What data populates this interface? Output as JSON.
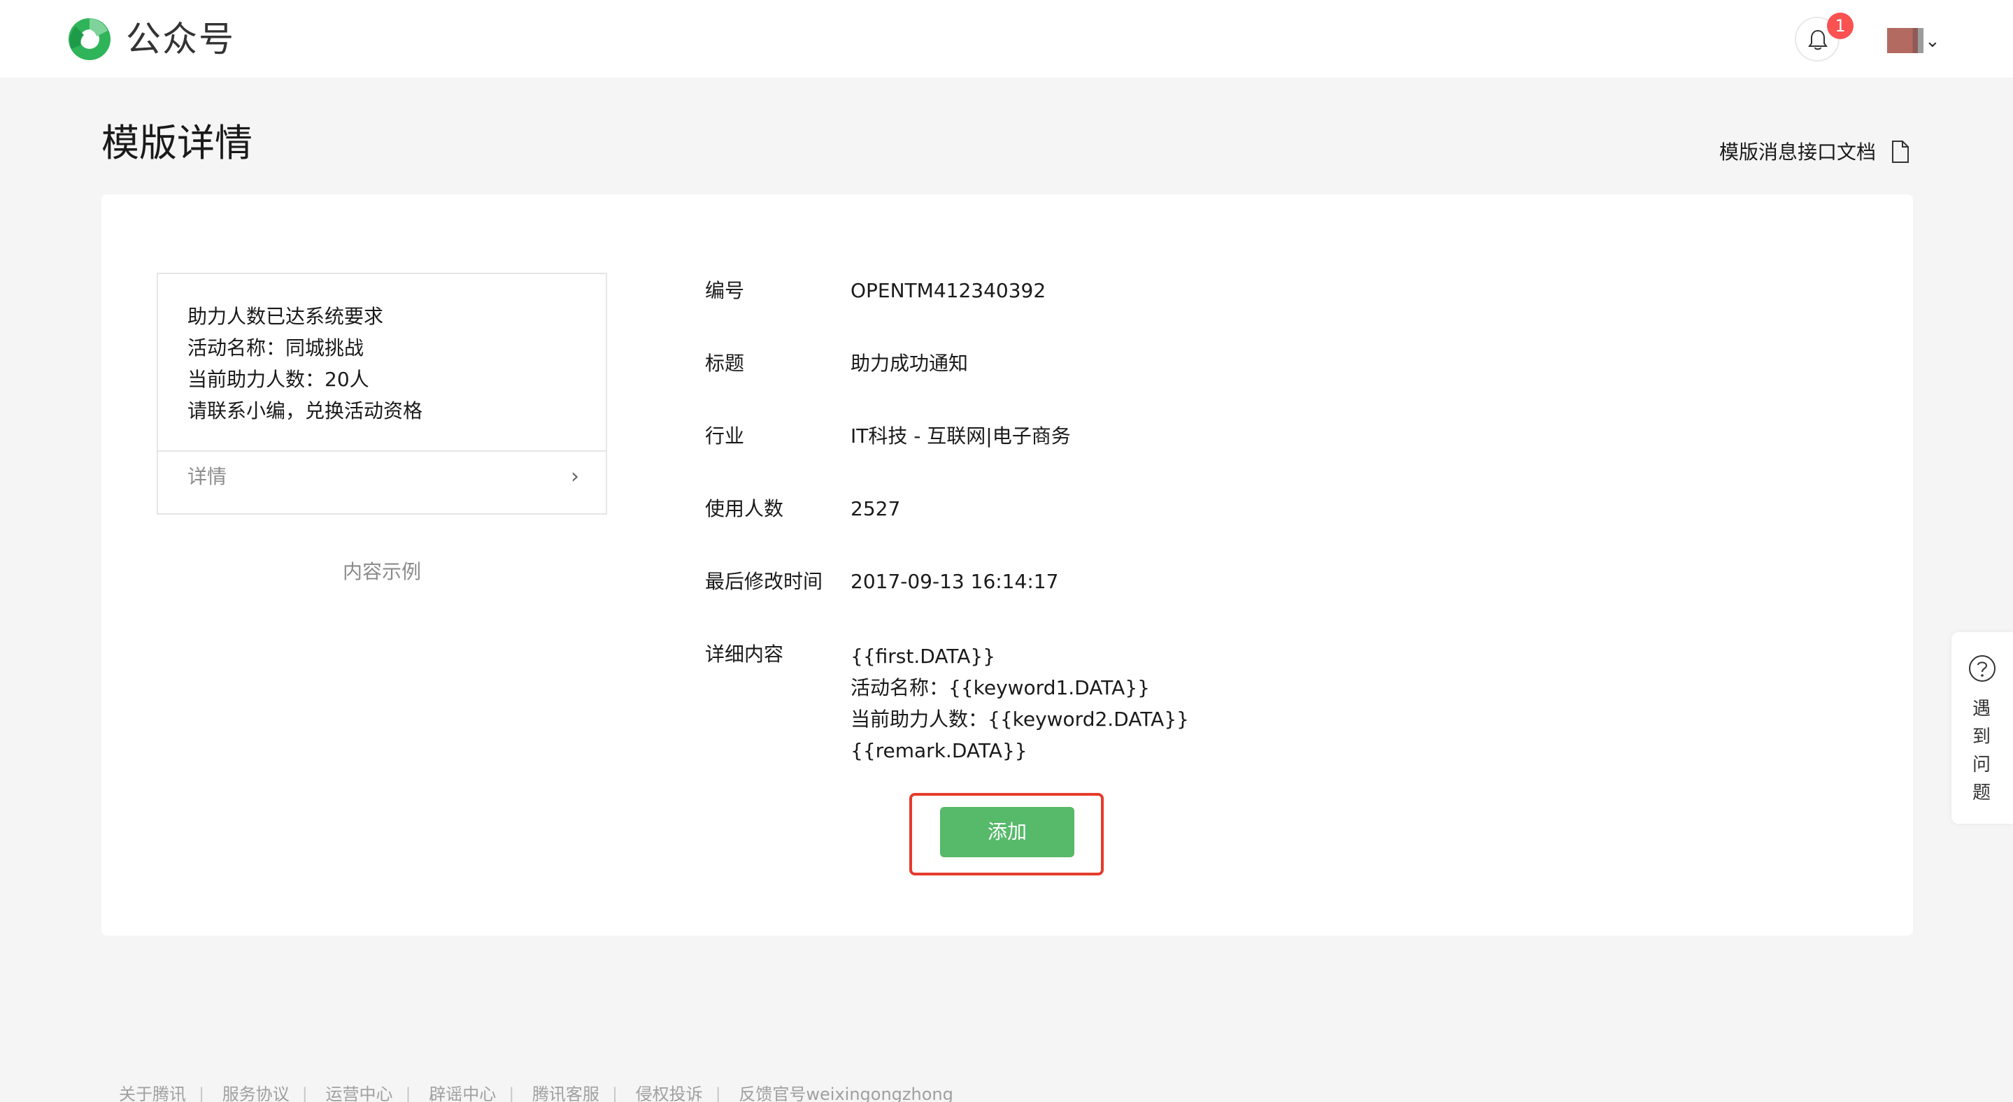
{
  "header": {
    "app_name": "公众号",
    "notification_count": "1"
  },
  "page": {
    "title": "模版详情",
    "doc_link": "模版消息接口文档"
  },
  "preview": {
    "lines": [
      "助力人数已达系统要求",
      "活动名称：同城挑战",
      "当前助力人数：20人",
      "请联系小编，兑换活动资格"
    ],
    "detail_label": "详情",
    "caption": "内容示例"
  },
  "fields": [
    {
      "label": "编号",
      "value": "OPENTM412340392"
    },
    {
      "label": "标题",
      "value": "助力成功通知"
    },
    {
      "label": "行业",
      "value": "IT科技 - 互联网|电子商务"
    },
    {
      "label": "使用人数",
      "value": "2527"
    },
    {
      "label": "最后修改时间",
      "value": "2017-09-13 16:14:17"
    }
  ],
  "detail_content": {
    "label": "详细内容",
    "lines": [
      "{{first.DATA}}",
      "活动名称：{{keyword1.DATA}}",
      "当前助力人数：{{keyword2.DATA}}",
      "{{remark.DATA}}"
    ]
  },
  "actions": {
    "add_label": "添加"
  },
  "help": {
    "label": "遇到问题"
  },
  "footer": {
    "links": [
      "关于腾讯",
      "服务协议",
      "运营中心",
      "辟谣中心",
      "腾讯客服",
      "侵权投诉",
      "反馈官号weixingongzhong"
    ]
  },
  "colors": {
    "brand_green": "#57b96a",
    "highlight_red": "#e53b2c",
    "badge_red": "#fa5151"
  }
}
